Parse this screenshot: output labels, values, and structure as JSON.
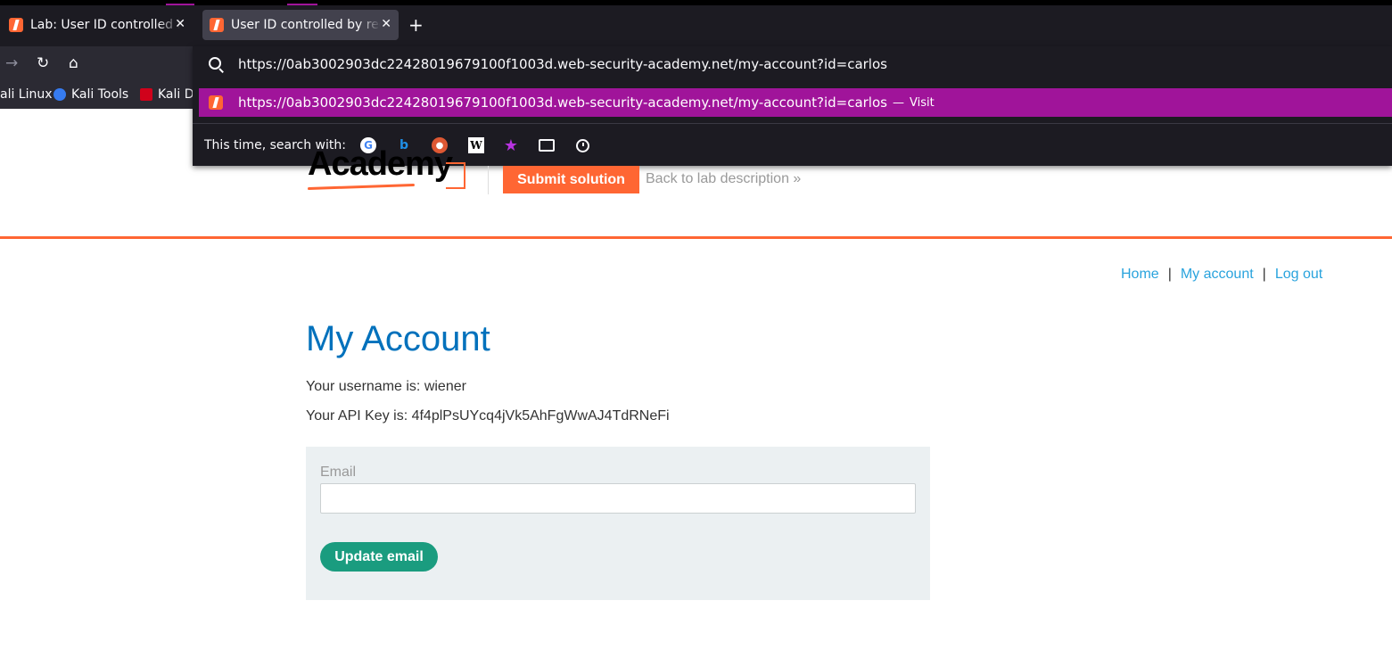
{
  "browser": {
    "tabs": [
      {
        "label": "Lab: User ID controlled by request parameter, with unpredictable user IDs",
        "active": false
      },
      {
        "label": "User ID controlled by request parameter, with unpredictable user IDs",
        "active": true
      }
    ],
    "url": "https://0ab3002903dc22428019679100f1003d.web-security-academy.net/my-account?id=carlos",
    "suggestion": {
      "url": "https://0ab3002903dc22428019679100f1003d.web-security-academy.net/my-account?id=carlos",
      "dash": "—",
      "action": "Visit"
    },
    "search_with_label": "This time, search with:",
    "bookmarks": [
      "ali Linux",
      "Kali Tools",
      "Kali Do"
    ],
    "accent": "#a0149a"
  },
  "header": {
    "logo_text": "Academy",
    "submit_label": "Submit solution",
    "back_label": "Back to lab description »",
    "accent": "#ff6633"
  },
  "nav": {
    "home": "Home",
    "sep1": "|",
    "account": "My account",
    "sep2": "|",
    "logout": "Log out"
  },
  "main": {
    "title": "My Account",
    "username_line": "Your username is: wiener",
    "apikey_line": "Your API Key is: 4f4plPsUYcq4jVk5AhFgWwAJ4TdRNeFi",
    "email_label": "Email",
    "email_value": "",
    "update_label": "Update email"
  }
}
